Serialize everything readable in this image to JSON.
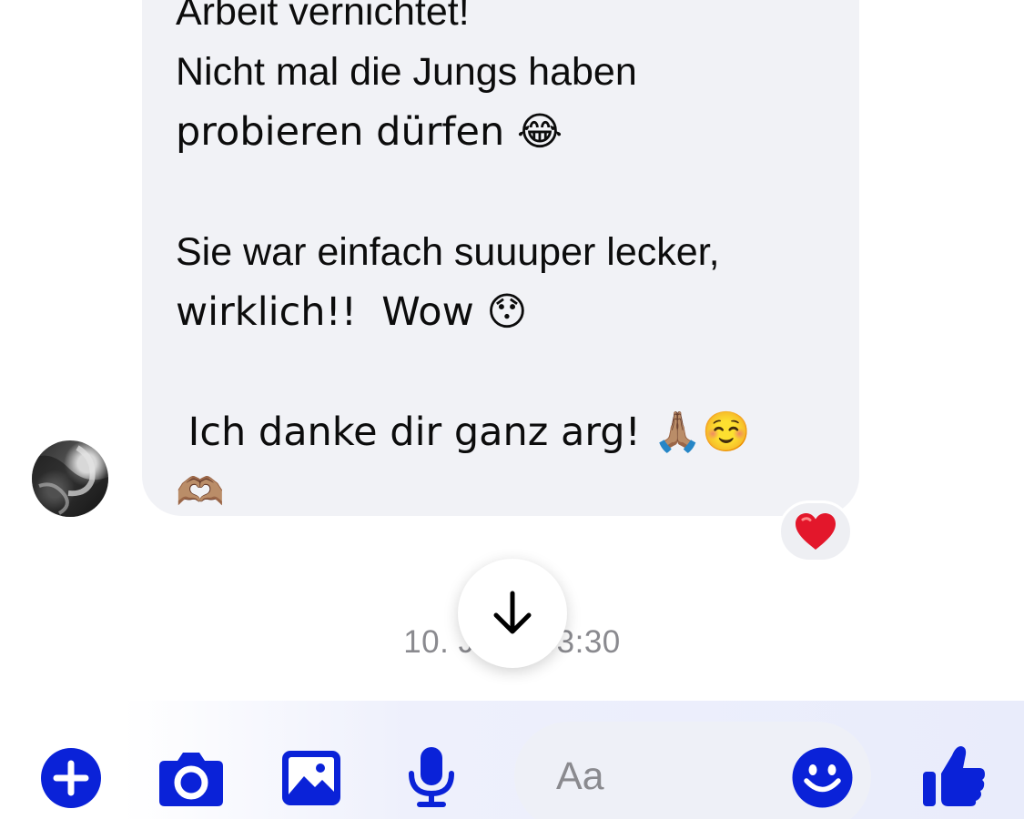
{
  "message": {
    "lines": [
      "Arbeit vernichtet!",
      "Nicht mal die Jungs haben",
      "probieren dürfen 😂",
      "",
      "Sie war einfach suuuper lecker,",
      "wirklich!!  Wow 😯",
      "",
      " Ich danke dir ganz arg! 🙏🏽☺️",
      "🫶🏽"
    ],
    "reaction": "❤️",
    "reaction_icon": "red-heart-icon"
  },
  "timestamp": "10. JAN. 03:30",
  "scroll_button": {
    "icon": "arrow-down-icon"
  },
  "composer": {
    "placeholder": "Aa",
    "actions": [
      {
        "icon": "plus-circle-icon"
      },
      {
        "icon": "camera-icon"
      },
      {
        "icon": "image-icon"
      },
      {
        "icon": "microphone-icon"
      }
    ],
    "emoji_icon": "smiley-icon",
    "like_icon": "thumbs-up-icon"
  },
  "colors": {
    "accent": "#0a22d8",
    "bubble": "#f1f2f6",
    "text": "#0c0c0c",
    "muted": "#8a8a8f"
  }
}
